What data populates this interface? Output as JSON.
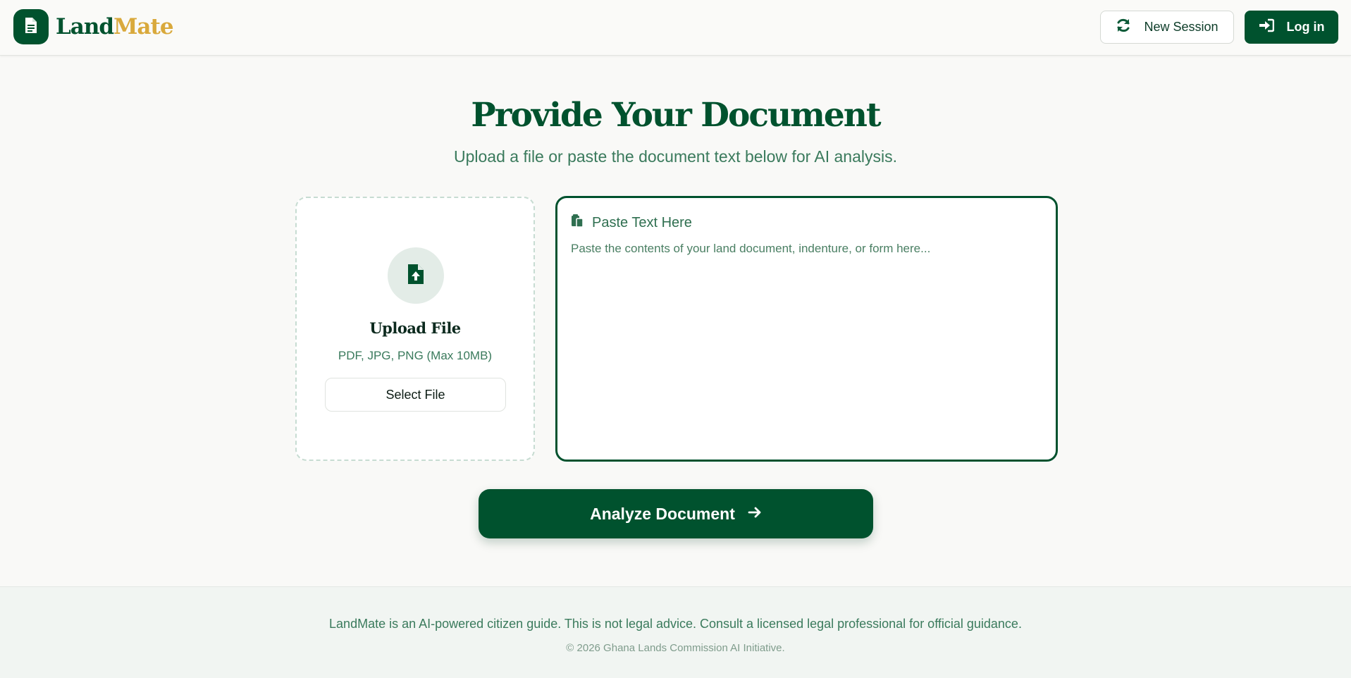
{
  "header": {
    "brand_part1": "Land",
    "brand_part2": "Mate",
    "new_session_label": "New Session",
    "login_label": "Log in"
  },
  "hero": {
    "title": "Provide Your Document",
    "subtitle": "Upload a file or paste the document text below for AI analysis."
  },
  "upload": {
    "title": "Upload File",
    "hint": "PDF, JPG, PNG (Max 10MB)",
    "select_label": "Select File"
  },
  "paste": {
    "label": "Paste Text Here",
    "placeholder": "Paste the contents of your land document, indenture, or form here...",
    "value": ""
  },
  "actions": {
    "analyze_label": "Analyze Document"
  },
  "footer": {
    "note": "LandMate is an AI-powered citizen guide. This is not legal advice. Consult a licensed legal professional for official guidance.",
    "copyright": "© 2026 Ghana Lands Commission AI Initiative."
  },
  "colors": {
    "primary": "#00522e",
    "accent": "#d9a93c",
    "muted_text": "#3a7a5c"
  },
  "icons": {
    "logo": "document-icon",
    "new_session": "refresh-icon",
    "login": "sign-in-icon",
    "upload": "file-upload-icon",
    "paste": "clipboard-icon",
    "analyze": "arrow-right-icon"
  }
}
